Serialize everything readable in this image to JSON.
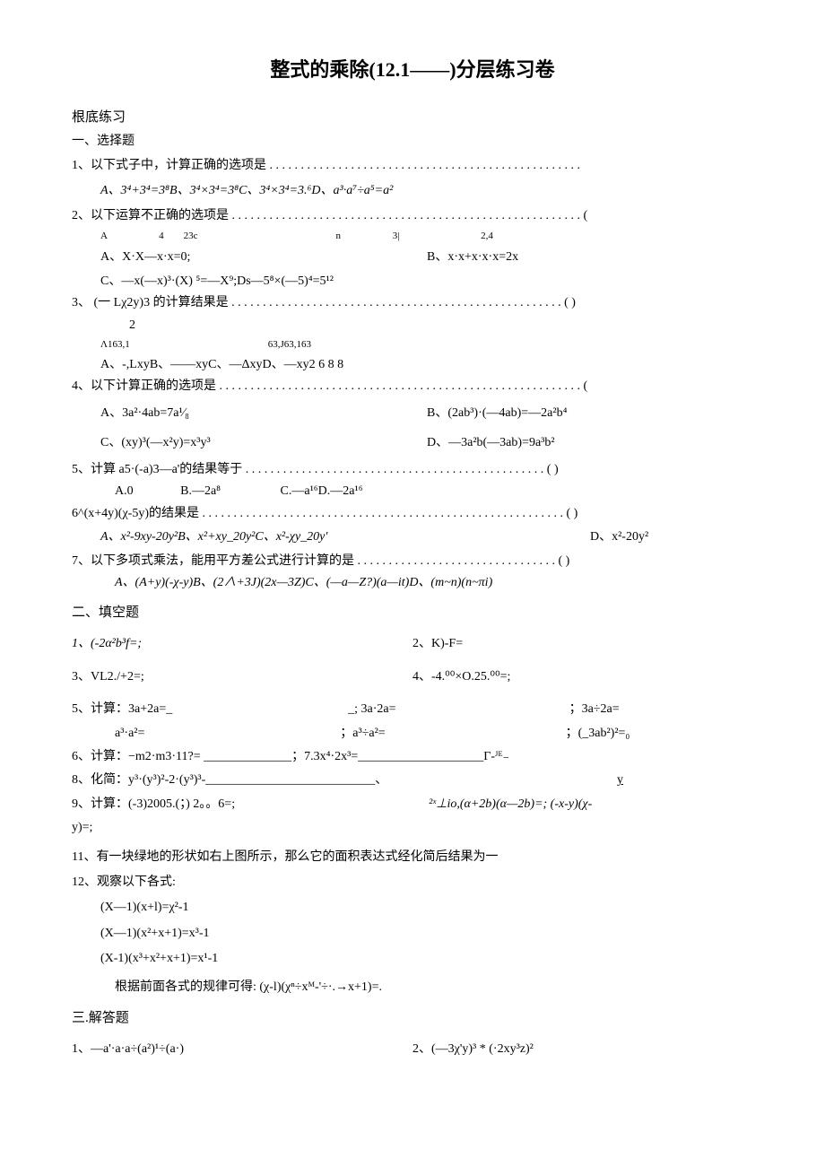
{
  "title": "整式的乘除(12.1——)分层练习卷",
  "root_section": "根底练习",
  "sec1_head": "一、选择题",
  "q1": {
    "stem": "1、以下式子中，计算正确的选项是 . . . . . . . . . . . . . . . . . . . . . . . . . . . . . . . . . . . . . . . . . . . . . . . . . .",
    "opts": "A、3⁴+3⁴=3⁸B、3⁴×3⁴=3⁸C、3⁴×3⁴=3.⁶D、a³·a⁷÷a⁵=a²"
  },
  "q2": {
    "stem": "2、以下运算不正确的选项是 . . . . . . . . . . . . . . . . . . . . . . . . . . . . . . . . . . . . . . . . . . . . . . . . . . . . . . . . (",
    "sup_line": "A                     4        23c                                                        n                     3|                                 2,4",
    "lineA": "A、X·X—x·x=0;",
    "lineB": "B、x·x+x·x·x=2x",
    "lineC": "C、—x(—x)³·(X) ⁵=—X⁹;Ds—5⁸×(—5)⁴=5¹²"
  },
  "q3": {
    "stem": "3、   (一 Lχ2y)3 的计算结果是 . . . . . . . . . . . . . . . . . . . . . . . . . . . . . . . . . . . . . . . . . . . . . . . . . . . . . (           )",
    "frac": "2",
    "sup_line": "Λ163,1                                                        63,J63,163",
    "opts": "A、-,LxyB、——xyC、—ΔxyD、—xy2   6              8 8"
  },
  "q4": {
    "stem": "4、以下计算正确的选项是 . . . . . . . . . . . . . . . . . . . . . . . . . . . . . . . . . . . . . . . . . . . . . . . . . . . . . . . . . . (",
    "row1a": "A、3a²·4ab=7a¹⁄₈",
    "row1b": "B、(2ab³)·(—4ab)=—2a²b⁴",
    "row2c": "C、(xy)³(—x²y)=x³y³",
    "row2d": "D、—3a²b(—3ab)=9a³b²"
  },
  "q5": {
    "stem": "5、计算 a5·(-a)3—a'的结果等于 . . . . . . . . . . . . . . . . . . . . . . . . . . . . . . . . . . . . . . . . . . . . . . . . (           )",
    "opts": "A.0               B.—2a⁸                   C.—a¹⁶D.—2a¹⁶"
  },
  "q6": {
    "stem": "6^(x+4y)(χ-5y)的结果是 . . . . . . . . . . . . . . . . . . . . . . . . . . . . . . . . . . . . . . . . . . . . . . . . . . . . . . . . . . (           )",
    "opts": "A、x²-9xy-20y²B、x²+xy_20y²C、x²-χy_20y'",
    "optsD": "D、x²-20y²"
  },
  "q7": {
    "stem": "7、以下多项式乘法，能用平方差公式进行计算的是 . . . . . . . . . . . . . . . . . . . . . . . . . . . . . . . . (           )",
    "opts": "A、(A+y)(-χ-y)B、(2∧+3J)(2x—3Z)C、(—a—Z?)(a—it)D、(m~n)(n~πi)"
  },
  "sec2_head": "二、填空题",
  "f1": "1、(-2α²b³f=;",
  "f2": "2、K)-F=",
  "f3": "3、VL2./+2=;",
  "f4": "4、-4.⁰⁰×O.25.⁰⁰=;",
  "f5": {
    "label": "5、计算：3a+2a=_",
    "mid": "_; 3a·2a=",
    "r1": "；3a÷2a=",
    "row2a": "a³·a²=",
    "row2b": "；a³÷a²=",
    "row2c": "；(_3ab²)²=₀"
  },
  "f6": "6、计算：−m2·m3·11?=  ______________；7.3x⁴·2x³=____________________Γ-ᴶᴱ₋",
  "f8_left": "8、化简：y³·(y³)²-2·(y³)³-___________________________、",
  "f8_right": "y",
  "f9_left": "9、计算：(-3)2005.(；) 2。。6=;",
  "f9_right": "²ˣ⊥io,(α+2b)(α—2b)=;  (-x-y)(χ-",
  "f9_tail": "y)=;",
  "f11": "11、有一块绿地的形状如右上图所示，那么它的面积表达式经化简后结果为一",
  "f12_head": "12、观察以下各式:",
  "f12_a": "(X—1)(x+l)=χ²-1",
  "f12_b": "(X—1)(x²+x+1)=x³-1",
  "f12_c": "(X-1)(x³+x²+x+1)=x¹-1",
  "f12_rule": "根据前面各式的规律可得: (χ-l)(χⁿ÷xᴹ-'÷·.→x+1)=.",
  "sec3_head": "三.解答题",
  "a1": "1、—a'·a·a÷(a²)¹÷(a·)",
  "a2": "2、(—3χ'y)³ * (·2xy³z)²"
}
